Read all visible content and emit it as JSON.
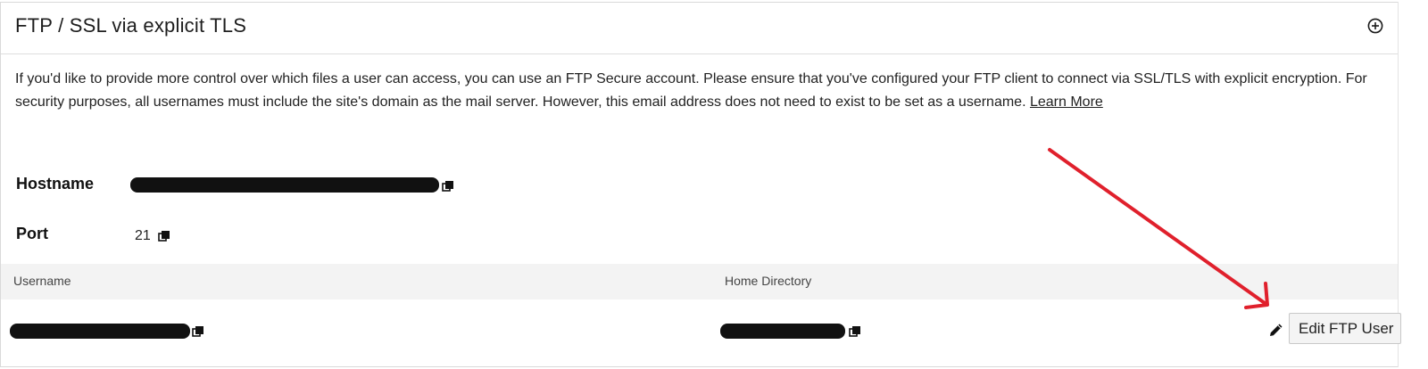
{
  "section": {
    "title": "FTP / SSL via explicit TLS",
    "description": "If you'd like to provide more control over which files a user can access, you can use an FTP Secure account. Please ensure that you've configured your FTP client to connect via SSL/TLS with explicit encryption. For security purposes, all usernames must include the site's domain as the mail server. However, this email address does not need to exist to be set as a username.",
    "learn_more": "Learn More"
  },
  "fields": {
    "hostname_label": "Hostname",
    "port_label": "Port",
    "port_value": "21"
  },
  "table": {
    "headers": [
      "Username",
      "Home Directory"
    ]
  },
  "actions": {
    "edit_button": "Edit FTP User"
  },
  "icons": [
    "plus-circle-icon",
    "copy-icon",
    "pencil-icon"
  ],
  "colors": {
    "annotation_arrow": "#e0202c",
    "table_header_bg": "#f3f3f3",
    "redaction": "#111111"
  }
}
